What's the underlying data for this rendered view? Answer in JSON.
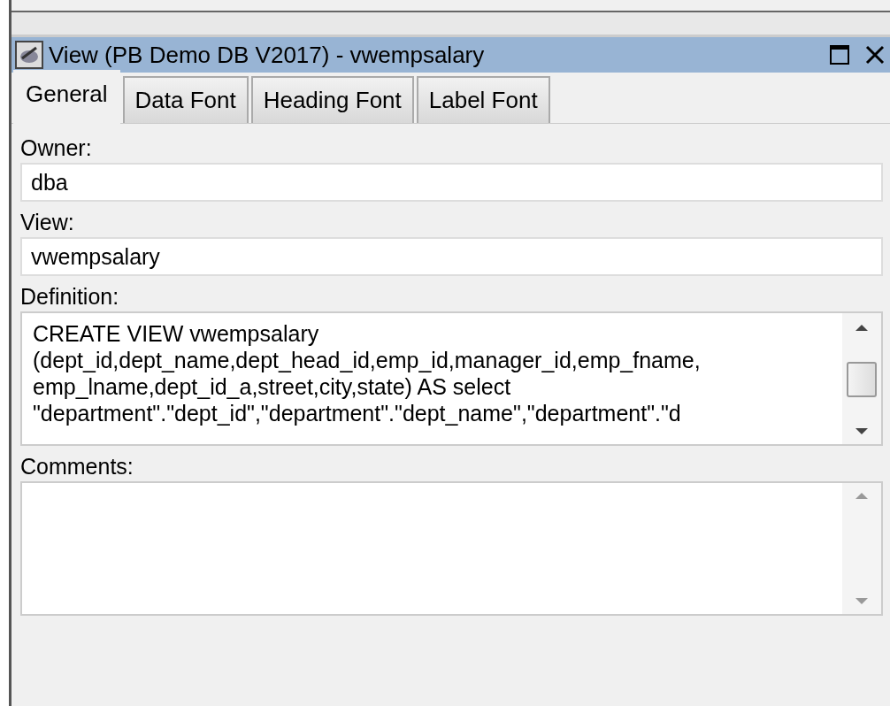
{
  "window": {
    "title": "View (PB Demo DB V2017) - vwempsalary"
  },
  "tabs": [
    {
      "label": "General",
      "selected": true
    },
    {
      "label": "Data Font",
      "selected": false
    },
    {
      "label": "Heading Font",
      "selected": false
    },
    {
      "label": "Label Font",
      "selected": false
    }
  ],
  "fields": [
    {
      "label": "Owner:",
      "value": "dba"
    },
    {
      "label": "View:",
      "value": "vwempsalary"
    }
  ],
  "definition": {
    "label": "Definition:",
    "lines": [
      "CREATE VIEW vwempsalary",
      "(dept_id,dept_name,dept_head_id,emp_id,manager_id,emp_fname,",
      "emp_lname,dept_id_a,street,city,state) AS select",
      "\"department\".\"dept_id\",\"department\".\"dept_name\",\"department\".\"d"
    ]
  },
  "comments": {
    "label": "Comments:"
  }
}
